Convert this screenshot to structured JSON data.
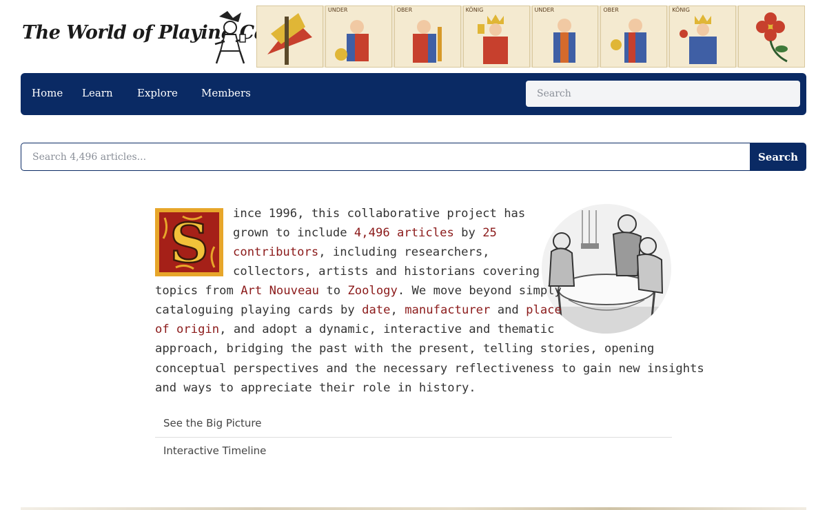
{
  "logo": {
    "text": "The World of Playing Cards"
  },
  "header": {
    "cards": [
      "",
      "UNDER",
      "OBER",
      "KÖNIG",
      "UNDER",
      "OBER",
      "KÖNIG",
      ""
    ]
  },
  "nav": {
    "items": [
      "Home",
      "Learn",
      "Explore",
      "Members"
    ],
    "search_placeholder": "Search"
  },
  "article_search": {
    "placeholder": "Search 4,496 articles...",
    "button_label": "Search"
  },
  "intro": {
    "dropcap": "S",
    "l1": "ince 1996, this collaborative project has",
    "l2a": "grown to include ",
    "l2_link1": "4,496 articles",
    "l2b": " by ",
    "l2_link2": "25",
    "l3_link": "contributors",
    "l3b": ", including researchers,",
    "l4": "collectors, artists and historians covering",
    "l5a": "topics from ",
    "l5_link1": "Art Nouveau",
    "l5b": " to ",
    "l5_link2": "Zoology",
    "l5c": ". We move beyond simply",
    "l6a": "cataloguing playing cards by ",
    "l6_link1": "date",
    "l6b": ", ",
    "l6_link2": "manufacturer",
    "l6c": " and ",
    "l6_link3": "place",
    "l7_link": "of origin",
    "l7b": ", and adopt a dynamic, interactive and thematic",
    "l8": "approach, bridging the past with the present, telling stories, opening",
    "l9": "conceptual perspectives and the necessary reflectiveness to gain new insights",
    "l10": "and ways to appreciate their role in history."
  },
  "links": [
    "See the Big Picture",
    "Interactive Timeline"
  ],
  "colors": {
    "nav_bg": "#0a2a64",
    "link": "#8b1a1a"
  }
}
